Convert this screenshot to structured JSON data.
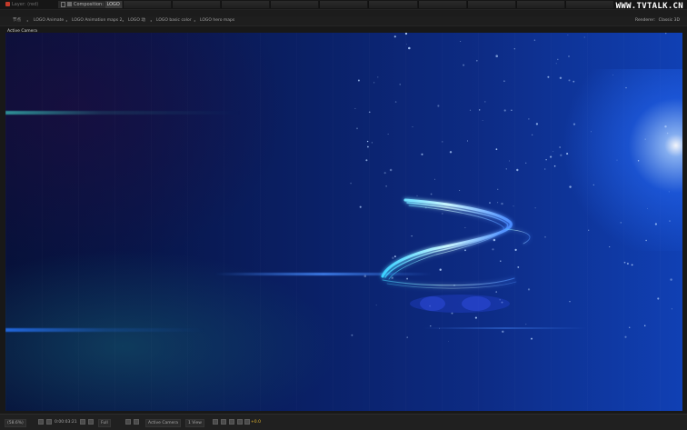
{
  "header": {
    "layer_tab": "Layer: (red)",
    "comp_tab_prefix": "Composition:",
    "comp_tab_name": "LOGO",
    "watermark": "WWW.TVTALK.CN"
  },
  "breadcrumbs": {
    "items": [
      "节点",
      "LOGO Animate",
      "LOGO Animation maps 2",
      "LOGO 动",
      "LOGO basic color",
      "LOGO hero maps"
    ],
    "renderer_label": "Renderer:",
    "renderer_value": "Classic 3D"
  },
  "viewer": {
    "camera_label": "Active Camera"
  },
  "bottom_bar": {
    "zoom": "(58.6%)",
    "timecode": "0:00:03:21",
    "resolution": "Full",
    "camera": "Active Camera",
    "view": "1 View",
    "exposure": "+0.0"
  },
  "colors": {
    "background_left": "#07113a",
    "background_right": "#1040b4",
    "swoosh": "#7fe8ff",
    "exposure": "#e0b32e"
  }
}
